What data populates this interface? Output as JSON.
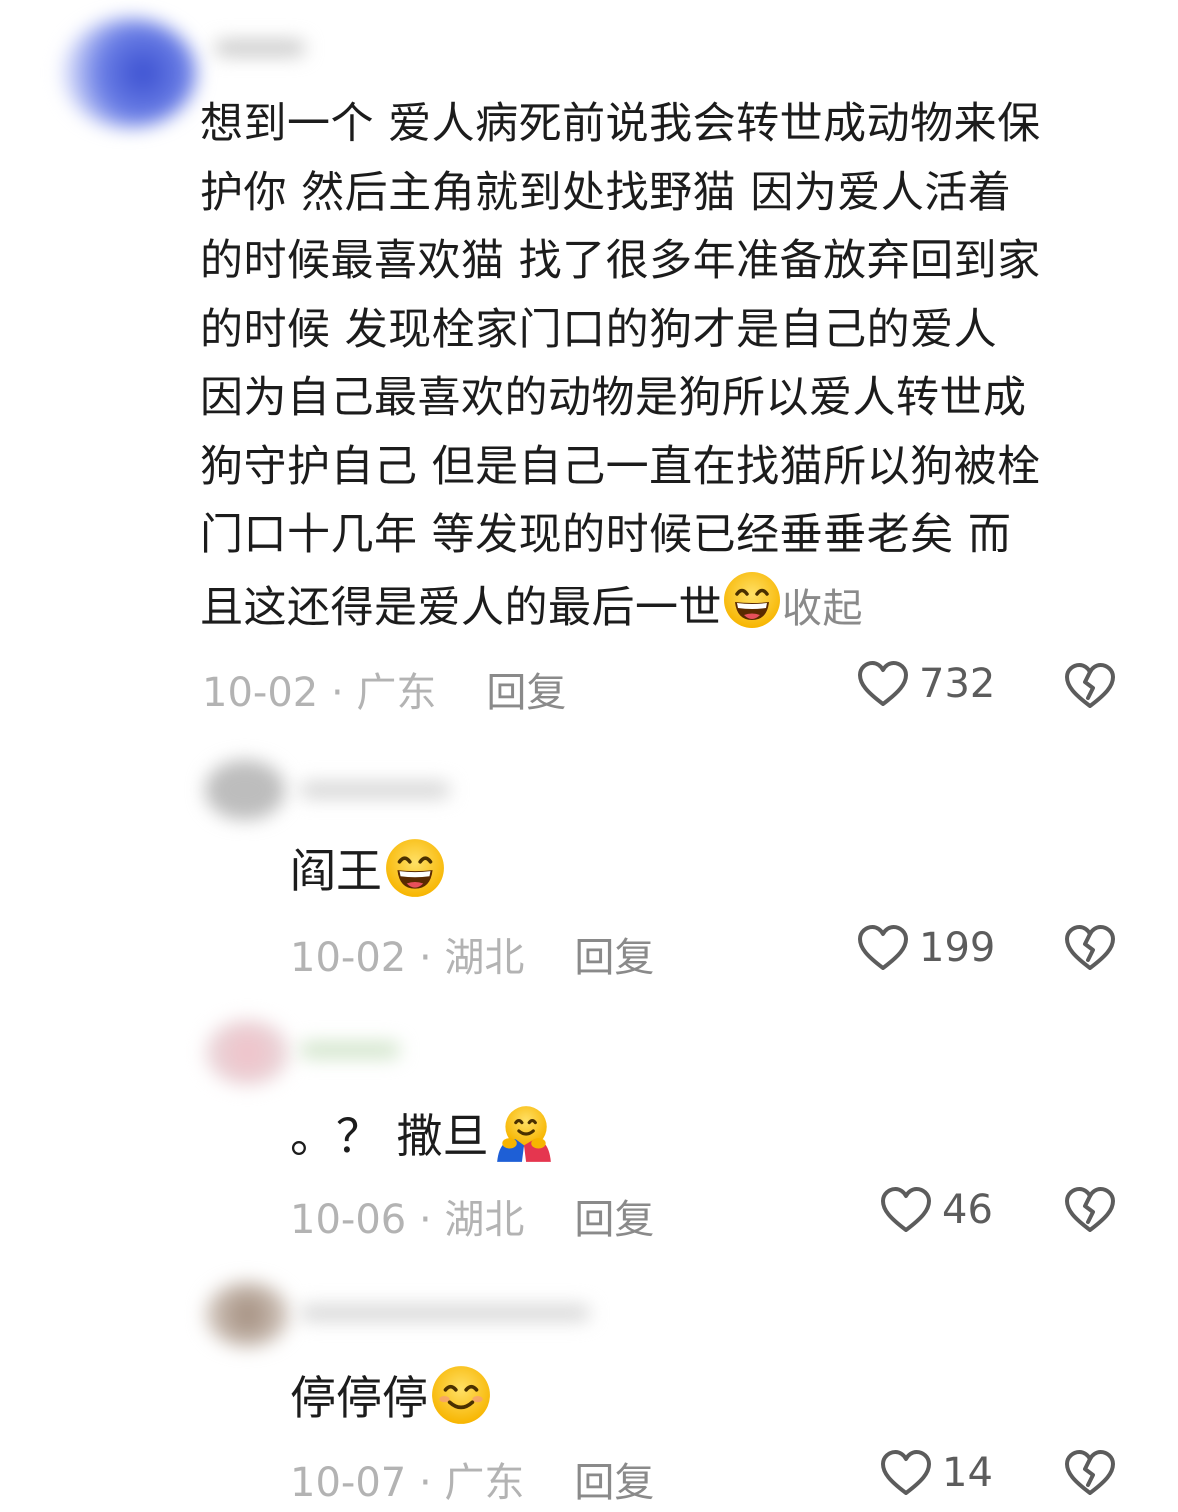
{
  "comments": [
    {
      "lines": [
        "想到一个 爱人病死前说我会转世成动物来保",
        "护你 然后主角就到处找野猫 因为爱人活着",
        "的时候最喜欢猫 找了很多年准备放弃回到家",
        "的时候 发现栓家门口的狗才是自己的爱人",
        "因为自己最喜欢的动物是狗所以爱人转世成",
        "狗守护自己 但是自己一直在找猫所以狗被栓",
        "门口十几年 等发现的时候已经垂垂老矣 而",
        "且这还得是爱人的最后一世"
      ],
      "collapse_label": "收起",
      "date_location": "10-02 · 广东",
      "reply_label": "回复",
      "likes": "732"
    },
    {
      "text": "阎王",
      "date_location": "10-02 · 湖北",
      "reply_label": "回复",
      "likes": "199"
    },
    {
      "text": "。？ 撒旦",
      "date_location": "10-06 · 湖北",
      "reply_label": "回复",
      "likes": "46"
    },
    {
      "text": "停停停",
      "date_location": "10-07 · 广东",
      "reply_label": "回复",
      "likes": "14"
    }
  ],
  "icons": {
    "like": "heart-outline-icon",
    "dislike": "broken-heart-icon",
    "emoji_grin": "grinning-face-icon",
    "emoji_hug": "hugging-face-icon",
    "emoji_smile": "smiling-face-icon"
  },
  "colors": {
    "text": "#1c1c1c",
    "meta": "#b3b3b3",
    "reply": "#8a8a8a"
  }
}
